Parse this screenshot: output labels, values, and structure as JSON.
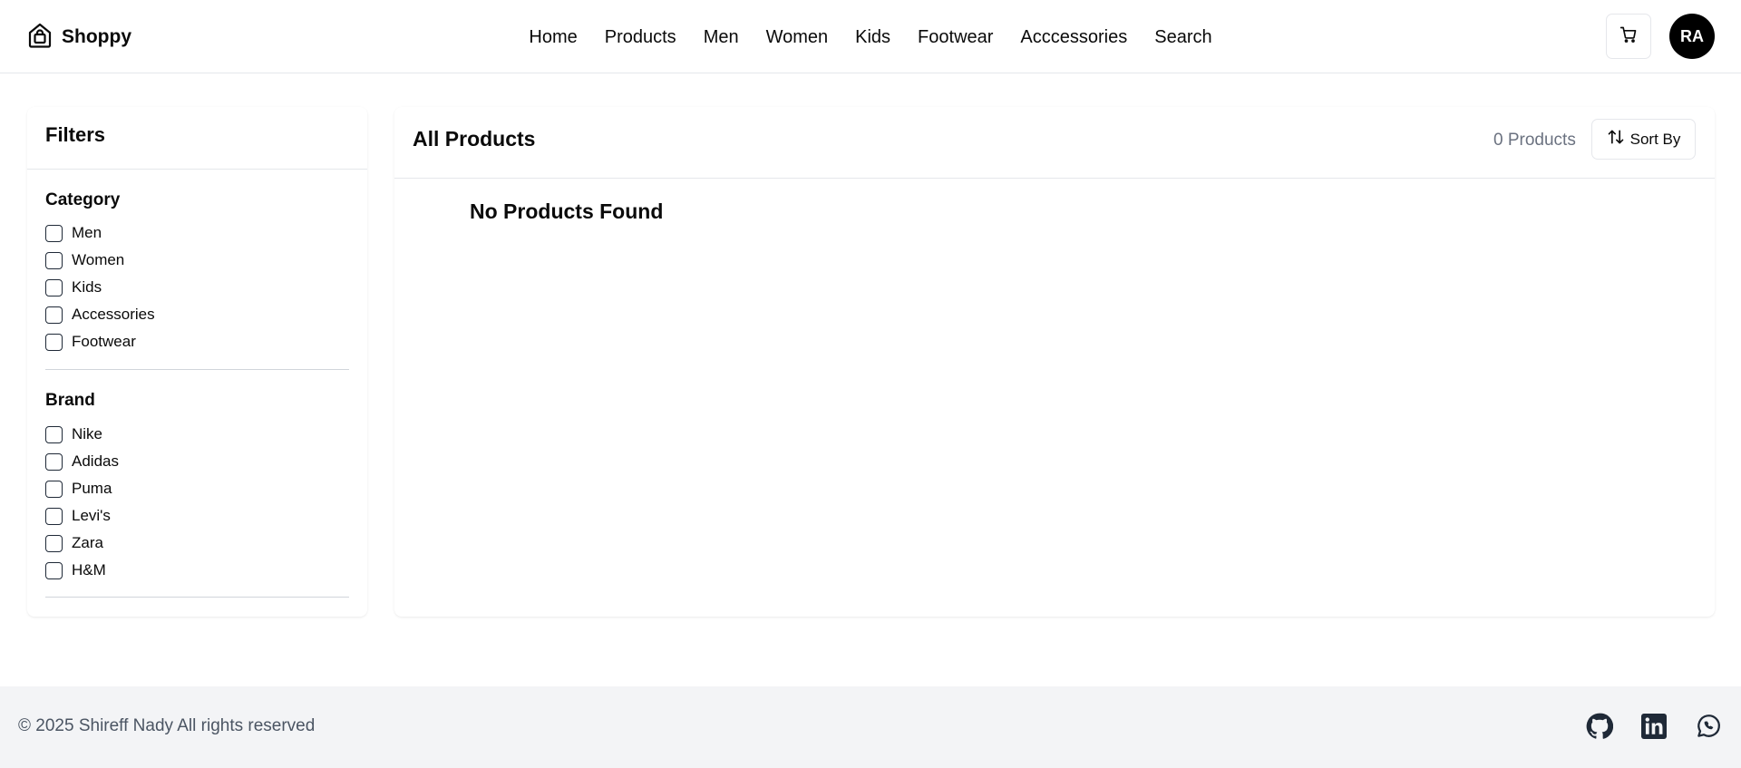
{
  "header": {
    "brand": "Shoppy",
    "nav": [
      "Home",
      "Products",
      "Men",
      "Women",
      "Kids",
      "Footwear",
      "Acccessories",
      "Search"
    ],
    "avatar_initials": "RA"
  },
  "filters": {
    "title": "Filters",
    "category": {
      "title": "Category",
      "options": [
        "Men",
        "Women",
        "Kids",
        "Accessories",
        "Footwear"
      ]
    },
    "brand": {
      "title": "Brand",
      "options": [
        "Nike",
        "Adidas",
        "Puma",
        "Levi's",
        "Zara",
        "H&M"
      ]
    }
  },
  "main": {
    "title": "All Products",
    "count": "0 Products",
    "sort_label": "Sort By",
    "empty_message": "No Products Found"
  },
  "footer": {
    "copyright": "© 2025 Shireff Nady All rights reserved"
  },
  "icons": {
    "brand": "house-bag-icon",
    "cart": "shopping-cart-icon",
    "sort": "sort-arrows-icon",
    "social": [
      "github-icon",
      "linkedin-icon",
      "whatsapp-icon"
    ]
  },
  "colors": {
    "text": "#0a0a0a",
    "muted": "#6b7280",
    "avatar_bg": "#000000",
    "footer_bg": "#f3f4f6"
  }
}
